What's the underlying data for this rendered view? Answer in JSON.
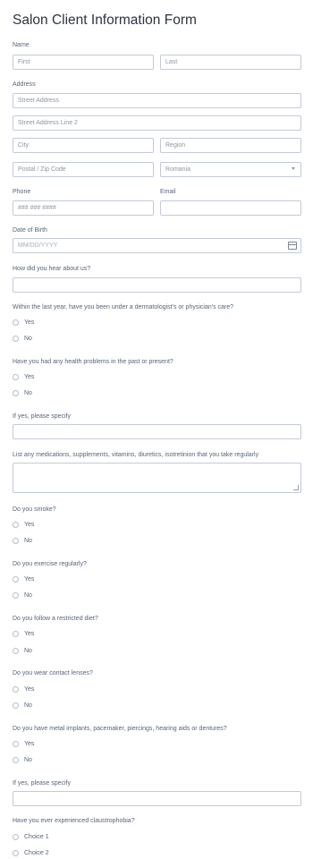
{
  "form": {
    "title": "Salon Client Information Form",
    "name": {
      "label": "Name",
      "first_placeholder": "First",
      "last_placeholder": "Last"
    },
    "address": {
      "label": "Address",
      "street_placeholder": "Street Address",
      "street2_placeholder": "Street Address Line 2",
      "city_placeholder": "City",
      "region_placeholder": "Region",
      "postal_placeholder": "Postal / Zip Code",
      "country_value": "Romania"
    },
    "phone": {
      "label": "Phone",
      "placeholder": "### ### ####"
    },
    "email": {
      "label": "Email"
    },
    "dob": {
      "label": "Date of Birth",
      "placeholder": "MM/DD/YYYY"
    },
    "heard": {
      "label": "How did you hear about us?"
    },
    "q_care": {
      "label": "Within the last year, have you been under a dermatologist's or physician's care?",
      "options": [
        "Yes",
        "No"
      ]
    },
    "q_health": {
      "label": "Have you had any health problems in the past or present?",
      "options": [
        "Yes",
        "No"
      ]
    },
    "specify1": {
      "label": "If yes, please specify"
    },
    "medications": {
      "label": "List any medications, supplements, vitamins, diuretics, isotretinion that you take regularly"
    },
    "q_smoke": {
      "label": "Do you smoke?",
      "options": [
        "Yes",
        "No"
      ]
    },
    "q_exercise": {
      "label": "Do you exercise regularly?",
      "options": [
        "Yes",
        "No"
      ]
    },
    "q_diet": {
      "label": "Do you follow a restricted diet?",
      "options": [
        "Yes",
        "No"
      ]
    },
    "q_lenses": {
      "label": "Do you wear contact lenses?",
      "options": [
        "Yes",
        "No"
      ]
    },
    "q_implants": {
      "label": "Do you have metal implants, pacemaker, piercings, hearing aids or dentures?",
      "options": [
        "Yes",
        "No"
      ]
    },
    "specify2": {
      "label": "If yes, please specify"
    },
    "q_claustro": {
      "label": "Have you ever experienced claustrophobia?",
      "options": [
        "Choice 1",
        "Choice 2"
      ]
    }
  }
}
